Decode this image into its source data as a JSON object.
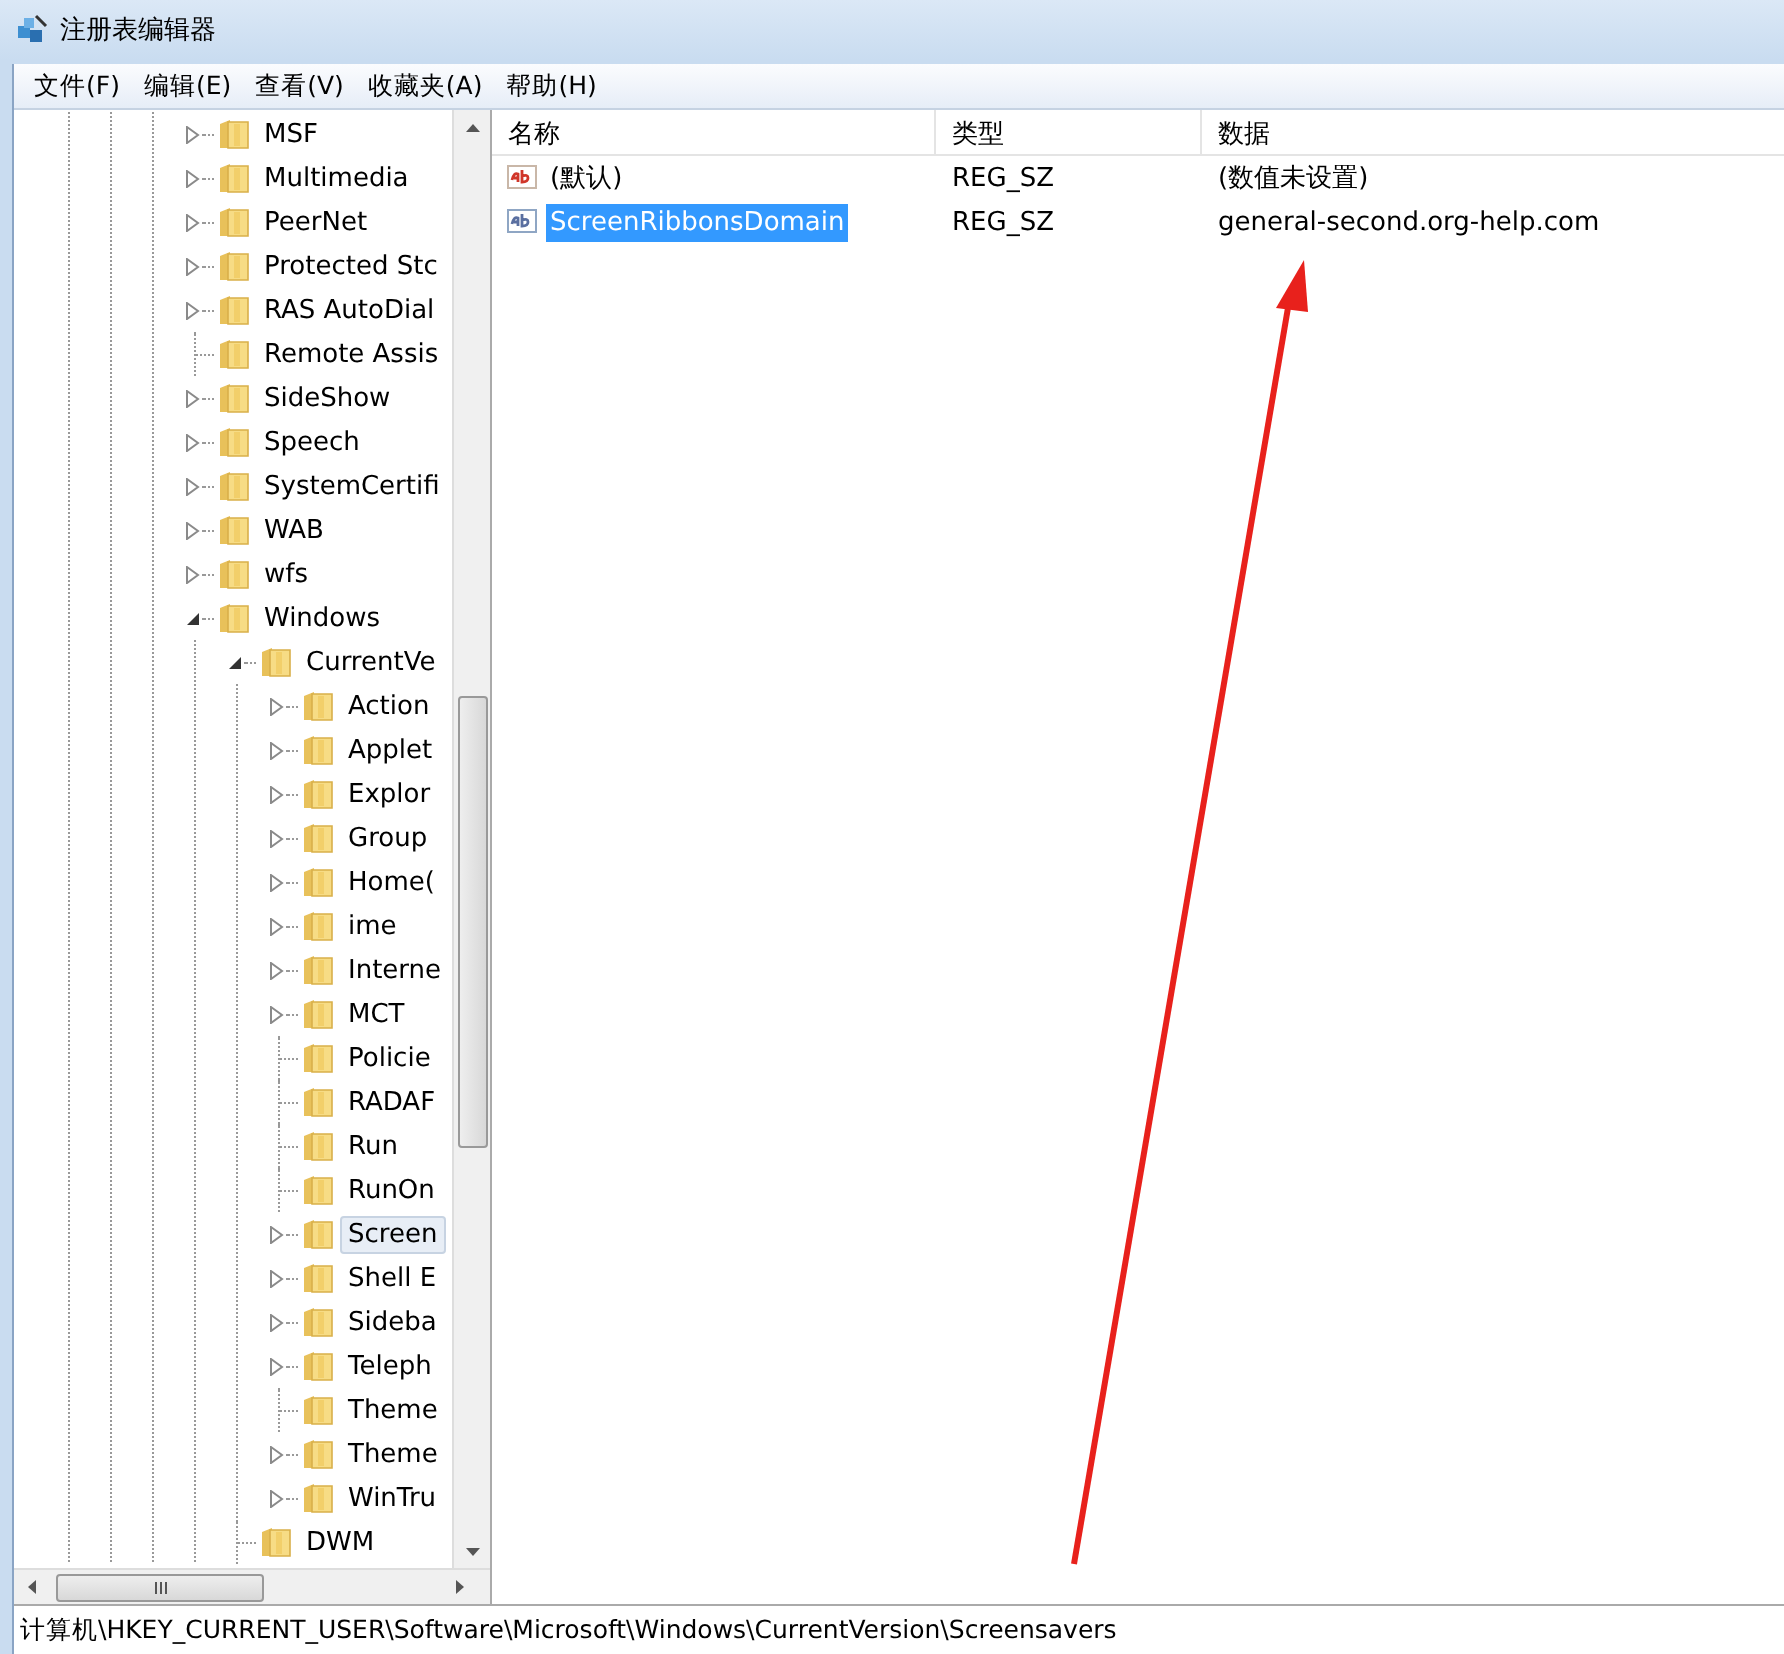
{
  "window": {
    "title": "注册表编辑器"
  },
  "menu": [
    "文件(F)",
    "编辑(E)",
    "查看(V)",
    "收藏夹(A)",
    "帮助(H)"
  ],
  "tree": [
    {
      "label": "MSF",
      "kind": "collapsed",
      "selected": false
    },
    {
      "label": "Multimedia",
      "kind": "collapsed",
      "selected": false
    },
    {
      "label": "PeerNet",
      "kind": "collapsed",
      "selected": false
    },
    {
      "label": "Protected Stc",
      "kind": "collapsed",
      "selected": false
    },
    {
      "label": "RAS AutoDial",
      "kind": "collapsed",
      "selected": false
    },
    {
      "label": "Remote Assis",
      "kind": "leaf",
      "selected": false
    },
    {
      "label": "SideShow",
      "kind": "collapsed",
      "selected": false
    },
    {
      "label": "Speech",
      "kind": "collapsed",
      "selected": false
    },
    {
      "label": "SystemCertifi",
      "kind": "collapsed",
      "selected": false
    },
    {
      "label": "WAB",
      "kind": "collapsed",
      "selected": false
    },
    {
      "label": "wfs",
      "kind": "collapsed",
      "selected": false
    },
    {
      "label": "Windows",
      "kind": "expanded",
      "selected": false,
      "children": [
        {
          "label": "CurrentVe",
          "kind": "expanded",
          "selected": false,
          "children": [
            {
              "label": "Action",
              "kind": "collapsed",
              "selected": false
            },
            {
              "label": "Applet",
              "kind": "collapsed",
              "selected": false
            },
            {
              "label": "Explor",
              "kind": "collapsed",
              "selected": false
            },
            {
              "label": "Group",
              "kind": "collapsed",
              "selected": false
            },
            {
              "label": "Home(",
              "kind": "collapsed",
              "selected": false
            },
            {
              "label": "ime",
              "kind": "collapsed",
              "selected": false
            },
            {
              "label": "Interne",
              "kind": "collapsed",
              "selected": false
            },
            {
              "label": "MCT",
              "kind": "collapsed",
              "selected": false
            },
            {
              "label": "Policie",
              "kind": "leaf",
              "selected": false
            },
            {
              "label": "RADAF",
              "kind": "leaf",
              "selected": false
            },
            {
              "label": "Run",
              "kind": "leaf",
              "selected": false
            },
            {
              "label": "RunOn",
              "kind": "leaf",
              "selected": false
            },
            {
              "label": "Screen",
              "kind": "collapsed",
              "selected": true
            },
            {
              "label": "Shell E",
              "kind": "collapsed",
              "selected": false
            },
            {
              "label": "Sideba",
              "kind": "collapsed",
              "selected": false
            },
            {
              "label": "Teleph",
              "kind": "collapsed",
              "selected": false
            },
            {
              "label": "Theme",
              "kind": "leaf",
              "selected": false
            },
            {
              "label": "Theme",
              "kind": "collapsed",
              "selected": false
            },
            {
              "label": "WinTru",
              "kind": "collapsed",
              "selected": false
            }
          ]
        },
        {
          "label": "DWM",
          "kind": "leaf",
          "selected": false
        }
      ]
    }
  ],
  "table": {
    "columns": [
      "名称",
      "类型",
      "数据"
    ],
    "rows": [
      {
        "name": "(默认)",
        "type": "REG_SZ",
        "data": "(数值未设置)",
        "selected": false
      },
      {
        "name": "ScreenRibbonsDomain",
        "type": "REG_SZ",
        "data": "general-second.org-help.com",
        "selected": true
      }
    ]
  },
  "status_bar": "计算机\\HKEY_CURRENT_USER\\Software\\Microsoft\\Windows\\CurrentVersion\\Screensavers"
}
